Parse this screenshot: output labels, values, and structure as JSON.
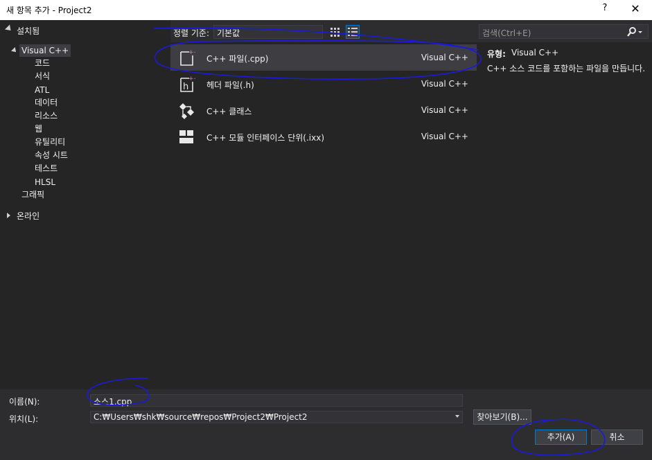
{
  "window": {
    "title": "새 항목 추가 - Project2",
    "help_label": "?",
    "close_label": "✕"
  },
  "tree": {
    "installed_label": "설치됨",
    "online_label": "온라인",
    "items": [
      {
        "label": "Visual C++"
      },
      {
        "label": "코드"
      },
      {
        "label": "서식"
      },
      {
        "label": "ATL"
      },
      {
        "label": "데이터"
      },
      {
        "label": "리소스"
      },
      {
        "label": "웹"
      },
      {
        "label": "유틸리티"
      },
      {
        "label": "속성 시트"
      },
      {
        "label": "테스트"
      },
      {
        "label": "HLSL"
      },
      {
        "label": "그래픽"
      }
    ]
  },
  "sort": {
    "label": "정렬 기준:",
    "value": "기본값"
  },
  "templates": [
    {
      "name": "C++ 파일(.cpp)",
      "lang": "Visual C++",
      "icon": "cpp-file-icon"
    },
    {
      "name": "헤더 파일(.h)",
      "lang": "Visual C++",
      "icon": "header-file-icon"
    },
    {
      "name": "C++ 클래스",
      "lang": "Visual C++",
      "icon": "class-icon"
    },
    {
      "name": "C++ 모듈 인터페이스 단위(.ixx)",
      "lang": "Visual C++",
      "icon": "module-icon"
    }
  ],
  "search": {
    "placeholder": "검색(Ctrl+E)"
  },
  "details": {
    "type_label": "유형:",
    "type_value": "Visual C++",
    "description": "C++ 소스 코드를 포함하는 파일을 만듭니다."
  },
  "form": {
    "name_label": "이름(N):",
    "name_value": "소스1.cpp",
    "location_label": "위치(L):",
    "location_value": "C:₩Users₩shk₩source₩repos₩Project2₩Project2",
    "browse_label": "찾아보기(B)...",
    "add_label": "추가(A)",
    "cancel_label": "취소"
  },
  "colors": {
    "annotation": "#1a1adc",
    "accent": "#007acc"
  }
}
